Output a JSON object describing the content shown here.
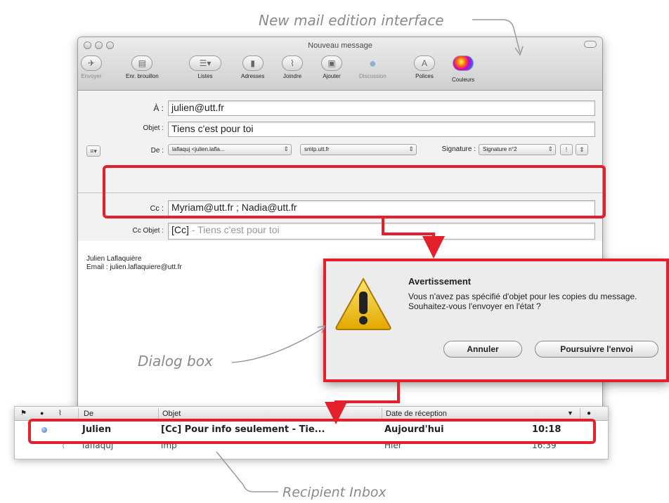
{
  "captions": {
    "top": "New mail edition interface",
    "dialog": "Dialog box",
    "inbox": "Recipient Inbox"
  },
  "window": {
    "title": "Nouveau message",
    "toolbar": [
      {
        "label": "Envoyer",
        "icon": "send-icon",
        "enabled": false
      },
      {
        "label": "Enr. brouillon",
        "icon": "save-draft-icon",
        "enabled": true
      },
      {
        "label": "Listes",
        "icon": "lists-icon",
        "enabled": true
      },
      {
        "label": "Adresses",
        "icon": "address-book-icon",
        "enabled": true
      },
      {
        "label": "Joindre",
        "icon": "attach-icon",
        "enabled": true
      },
      {
        "label": "Ajouter",
        "icon": "add-icon",
        "enabled": true
      },
      {
        "label": "Discussion",
        "icon": "chat-bubble-icon",
        "enabled": false
      },
      {
        "label": "Polices",
        "icon": "fonts-icon",
        "enabled": true
      },
      {
        "label": "Couleurs",
        "icon": "colors-icon",
        "enabled": true
      }
    ],
    "to_label": "À :",
    "to_value": "julien@utt.fr",
    "subject_label": "Objet :",
    "subject_value": "Tiens c'est pour toi",
    "from_label": "De :",
    "from_value": "laflaquj <julien.lafla...",
    "smtp_value": "smtp.utt.fr",
    "signature_label": "Signature :",
    "signature_value": "Signature n°2",
    "cc_label": "Cc :",
    "cc_value": "Myriam@utt.fr ; Nadia@utt.fr",
    "cc_subject_label": "Cc Objet :",
    "cc_subject_prefix": "[Cc]",
    "cc_subject_rest": " - Tiens c'est pour toi",
    "signature_name": "Julien Laflaquière",
    "signature_email": "Email : julien.laflaquiere@utt.fr"
  },
  "dialog": {
    "title": "Avertissement",
    "message": "Vous n'avez pas spécifié d'objet pour les copies du message. Souhaitez-vous l'envoyer en l'état ?",
    "cancel_label": "Annuler",
    "continue_label": "Poursuivre l'envoi"
  },
  "inbox": {
    "columns": {
      "from": "De",
      "subject": "Objet",
      "date": "Date de réception"
    },
    "rows": [
      {
        "from": "Julien",
        "subject": "[Cc] Pour info seulement - Tie...",
        "date": "Aujourd'hui",
        "time": "10:18",
        "unread": true
      },
      {
        "from": "laflaquj",
        "subject": "imp",
        "date": "Hier",
        "time": "16:39",
        "unread": false
      }
    ]
  },
  "colors": {
    "highlight": "#e3202b",
    "accent": "#3d6fd6"
  }
}
